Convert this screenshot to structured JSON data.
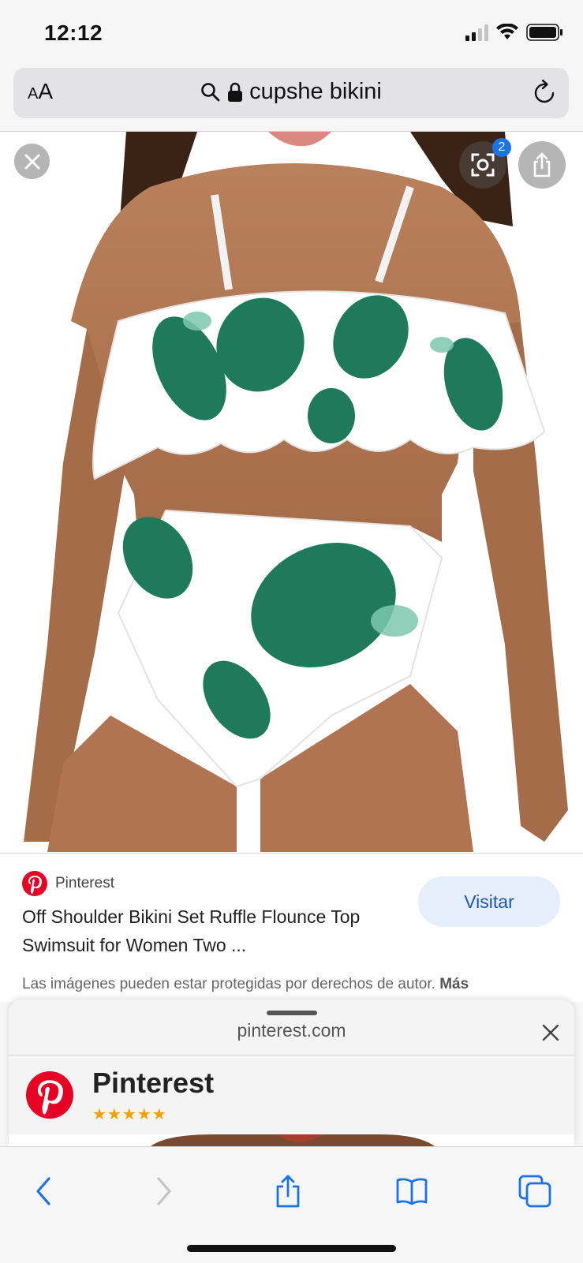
{
  "status_bar": {
    "time": "12:12"
  },
  "url_bar": {
    "aa_label_small": "A",
    "aa_label_large": "A",
    "url": "cupshe bikini"
  },
  "image_overlay": {
    "lens_badge_count": "2"
  },
  "result": {
    "source_name": "Pinterest",
    "title": "Off Shoulder Bikini Set Ruffle Flounce Top Swimsuit for Women Two ...",
    "visit_label": "Visitar",
    "copyright_text": "Las imágenes pueden estar protegidas por derechos de autor.",
    "more_label": "Más"
  },
  "sheet": {
    "domain": "pinterest.com",
    "app_name": "Pinterest",
    "rating": 5,
    "rating_stars": "★★★★★"
  },
  "colors": {
    "accent_blue": "#1a73e8",
    "pinterest_red": "#e60023",
    "visit_bg": "#e6eefb",
    "star_color": "#f4a100",
    "leaf_green": "#1f7a5c"
  }
}
